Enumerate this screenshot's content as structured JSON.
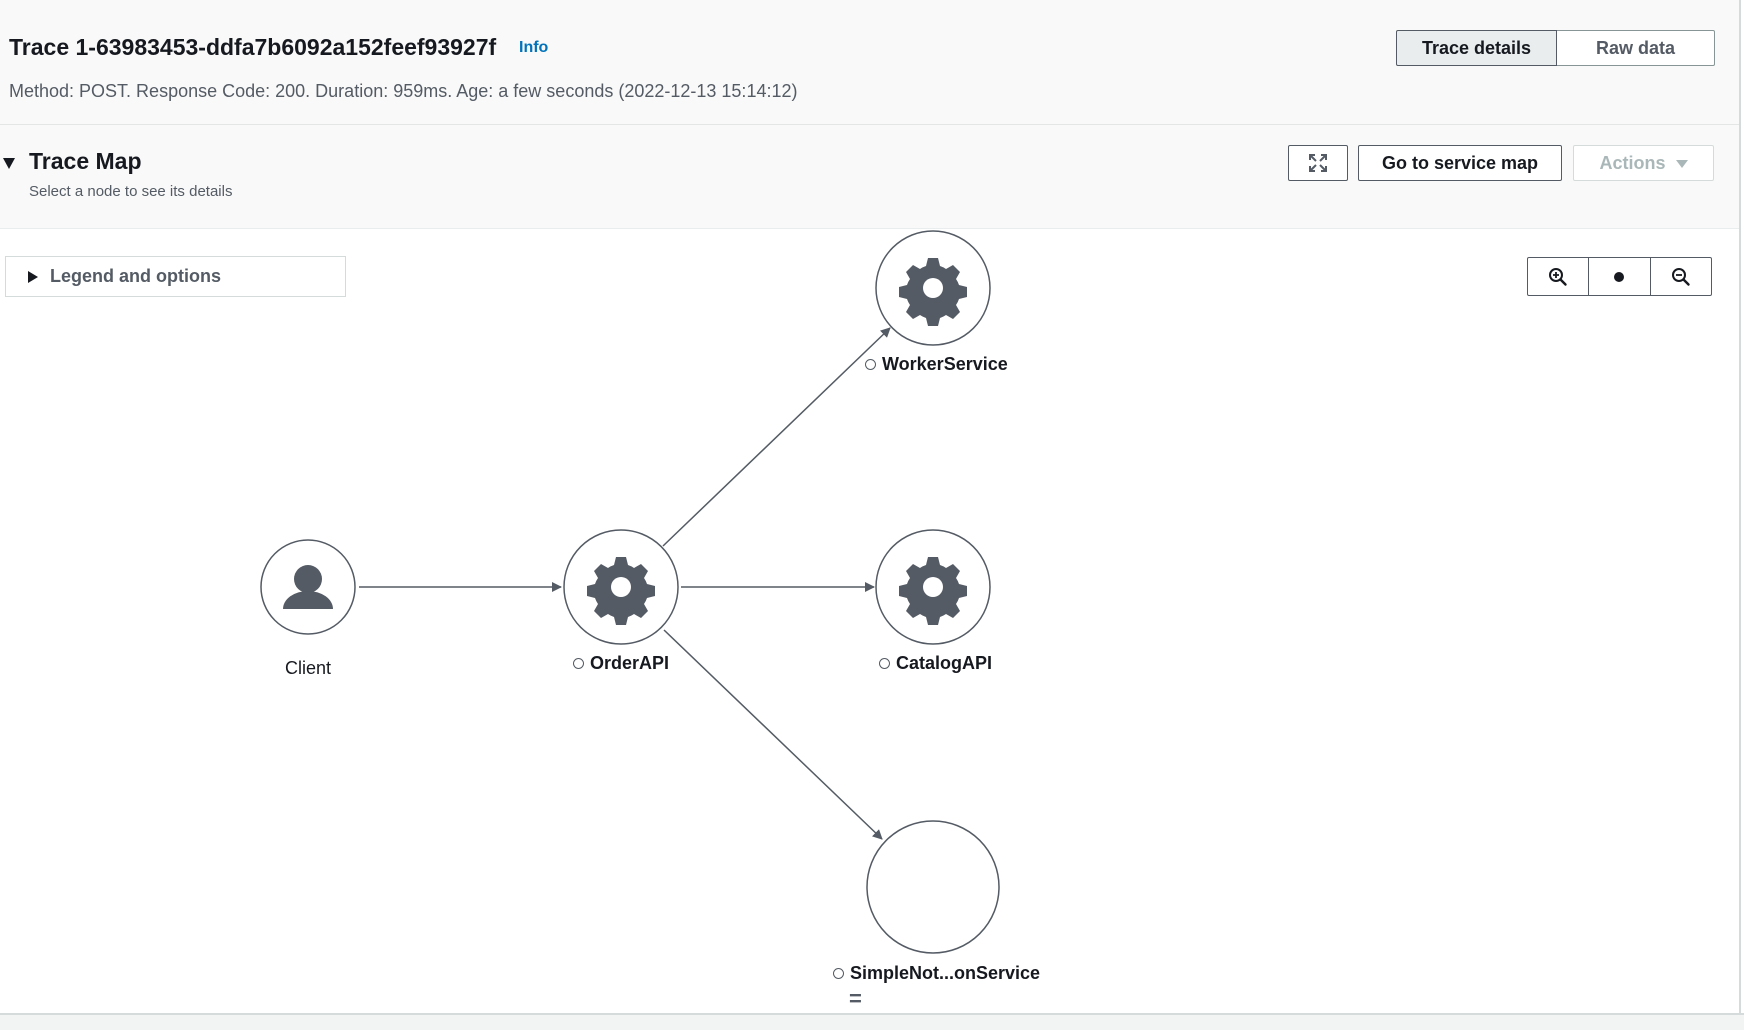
{
  "header": {
    "title": "Trace 1-63983453-ddfa7b6092a152feef93927f",
    "info": "Info",
    "meta": "Method: POST. Response Code: 200. Duration: 959ms. Age: a few seconds (2022-12-13 15:14:12)",
    "tabs": [
      {
        "label": "Trace details",
        "active": true
      },
      {
        "label": "Raw data",
        "active": false
      }
    ]
  },
  "trace_map": {
    "title": "Trace Map",
    "subtitle": "Select a node to see its details",
    "go_to_service_map": "Go to service map",
    "actions": "Actions",
    "legend": "Legend and options"
  },
  "nodes": {
    "client": "Client",
    "order_api": "OrderAPI",
    "worker_service": "WorkerService",
    "catalog_api": "CatalogAPI",
    "simple_notification": "SimpleNot...onService"
  },
  "icons": {
    "expand": "fullscreen-icon",
    "zoom_in": "zoom-in-icon",
    "reset": "reset-zoom-icon",
    "zoom_out": "zoom-out-icon",
    "node_service": "gear-icon",
    "node_client": "user-icon"
  },
  "colors": {
    "link": "#0073bb",
    "icon": "#545b64",
    "border": "#545b64"
  },
  "drag_handle": "="
}
